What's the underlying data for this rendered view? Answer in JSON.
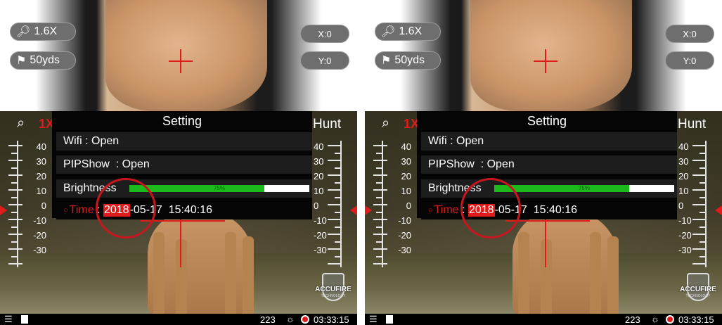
{
  "pip": {
    "zoom": "1.6X",
    "distance": "50yds",
    "x_offset": "X:0",
    "y_offset": "Y:0"
  },
  "main": {
    "zoom_marker": "1X",
    "mode": "Hunt",
    "scale_labels": [
      "40",
      "30",
      "20",
      "10",
      "0",
      "-10",
      "-20",
      "-30"
    ]
  },
  "menu": {
    "title": "Setting",
    "wifi_label": "Wifi",
    "wifi_value": "Open",
    "pip_label": "PIPShow",
    "pip_value": "Open",
    "brightness_label": "Brightness",
    "brightness_value": 0.75,
    "brightness_text": "75%",
    "time_label": "Time",
    "time_year": "2018",
    "time_rest": "-05-17  15:40:16"
  },
  "logo": {
    "brand": "ACCUFIRE",
    "sub": "TECHNOLOGY"
  },
  "status": {
    "count": "223",
    "clock": "03:33:15"
  },
  "colors": {
    "accent_red": "#e01b1b",
    "brightness_green": "#1bb91b",
    "menu_bg": "#050505"
  },
  "icons": [
    "search-icon",
    "flag-icon",
    "magnifier-icon",
    "wifi-icon",
    "sd-card-icon",
    "sun-icon",
    "record-icon"
  ]
}
